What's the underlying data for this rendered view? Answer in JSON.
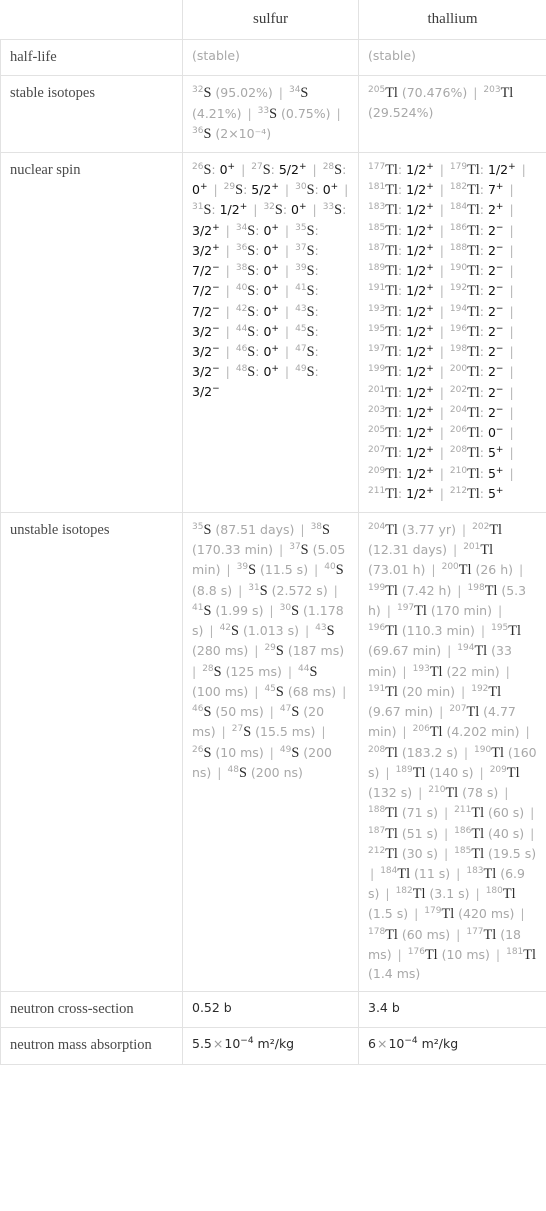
{
  "table": {
    "columns": [
      "",
      "sulfur",
      "thallium"
    ],
    "rows": [
      {
        "label": "half-life",
        "sulfur": "(stable)",
        "thallium": "(stable)"
      },
      {
        "label": "stable isotopes",
        "sulfur_items": [
          {
            "mass": "32",
            "sym": "S",
            "note": "(95.02%)"
          },
          {
            "mass": "34",
            "sym": "S",
            "note": "(4.21%)"
          },
          {
            "mass": "33",
            "sym": "S",
            "note": "(0.75%)"
          },
          {
            "mass": "36",
            "sym": "S",
            "note": "(2×10⁻⁴)"
          }
        ],
        "thallium_items": [
          {
            "mass": "205",
            "sym": "Tl",
            "note": "(70.476%)"
          },
          {
            "mass": "203",
            "sym": "Tl",
            "note": "(29.524%)"
          }
        ]
      },
      {
        "label": "nuclear spin",
        "sulfur_spins": [
          {
            "mass": "26",
            "sym": "S",
            "spin": "0",
            "sign": "+"
          },
          {
            "mass": "27",
            "sym": "S",
            "spin": "5/2",
            "sign": "+"
          },
          {
            "mass": "28",
            "sym": "S",
            "spin": "0",
            "sign": "+"
          },
          {
            "mass": "29",
            "sym": "S",
            "spin": "5/2",
            "sign": "+"
          },
          {
            "mass": "30",
            "sym": "S",
            "spin": "0",
            "sign": "+"
          },
          {
            "mass": "31",
            "sym": "S",
            "spin": "1/2",
            "sign": "+"
          },
          {
            "mass": "32",
            "sym": "S",
            "spin": "0",
            "sign": "+"
          },
          {
            "mass": "33",
            "sym": "S",
            "spin": "3/2",
            "sign": "+"
          },
          {
            "mass": "34",
            "sym": "S",
            "spin": "0",
            "sign": "+"
          },
          {
            "mass": "35",
            "sym": "S",
            "spin": "3/2",
            "sign": "+"
          },
          {
            "mass": "36",
            "sym": "S",
            "spin": "0",
            "sign": "+"
          },
          {
            "mass": "37",
            "sym": "S",
            "spin": "7/2",
            "sign": "−"
          },
          {
            "mass": "38",
            "sym": "S",
            "spin": "0",
            "sign": "+"
          },
          {
            "mass": "39",
            "sym": "S",
            "spin": "7/2",
            "sign": "−"
          },
          {
            "mass": "40",
            "sym": "S",
            "spin": "0",
            "sign": "+"
          },
          {
            "mass": "41",
            "sym": "S",
            "spin": "7/2",
            "sign": "−"
          },
          {
            "mass": "42",
            "sym": "S",
            "spin": "0",
            "sign": "+"
          },
          {
            "mass": "43",
            "sym": "S",
            "spin": "3/2",
            "sign": "−"
          },
          {
            "mass": "44",
            "sym": "S",
            "spin": "0",
            "sign": "+"
          },
          {
            "mass": "45",
            "sym": "S",
            "spin": "3/2",
            "sign": "−"
          },
          {
            "mass": "46",
            "sym": "S",
            "spin": "0",
            "sign": "+"
          },
          {
            "mass": "47",
            "sym": "S",
            "spin": "3/2",
            "sign": "−"
          },
          {
            "mass": "48",
            "sym": "S",
            "spin": "0",
            "sign": "+"
          },
          {
            "mass": "49",
            "sym": "S",
            "spin": "3/2",
            "sign": "−"
          }
        ],
        "thallium_spins": [
          {
            "mass": "177",
            "sym": "Tl",
            "spin": "1/2",
            "sign": "+"
          },
          {
            "mass": "179",
            "sym": "Tl",
            "spin": "1/2",
            "sign": "+"
          },
          {
            "mass": "181",
            "sym": "Tl",
            "spin": "1/2",
            "sign": "+"
          },
          {
            "mass": "182",
            "sym": "Tl",
            "spin": "7",
            "sign": "+"
          },
          {
            "mass": "183",
            "sym": "Tl",
            "spin": "1/2",
            "sign": "+"
          },
          {
            "mass": "184",
            "sym": "Tl",
            "spin": "2",
            "sign": "+"
          },
          {
            "mass": "185",
            "sym": "Tl",
            "spin": "1/2",
            "sign": "+"
          },
          {
            "mass": "186",
            "sym": "Tl",
            "spin": "2",
            "sign": "−"
          },
          {
            "mass": "187",
            "sym": "Tl",
            "spin": "1/2",
            "sign": "+"
          },
          {
            "mass": "188",
            "sym": "Tl",
            "spin": "2",
            "sign": "−"
          },
          {
            "mass": "189",
            "sym": "Tl",
            "spin": "1/2",
            "sign": "+"
          },
          {
            "mass": "190",
            "sym": "Tl",
            "spin": "2",
            "sign": "−"
          },
          {
            "mass": "191",
            "sym": "Tl",
            "spin": "1/2",
            "sign": "+"
          },
          {
            "mass": "192",
            "sym": "Tl",
            "spin": "2",
            "sign": "−"
          },
          {
            "mass": "193",
            "sym": "Tl",
            "spin": "1/2",
            "sign": "+"
          },
          {
            "mass": "194",
            "sym": "Tl",
            "spin": "2",
            "sign": "−"
          },
          {
            "mass": "195",
            "sym": "Tl",
            "spin": "1/2",
            "sign": "+"
          },
          {
            "mass": "196",
            "sym": "Tl",
            "spin": "2",
            "sign": "−"
          },
          {
            "mass": "197",
            "sym": "Tl",
            "spin": "1/2",
            "sign": "+"
          },
          {
            "mass": "198",
            "sym": "Tl",
            "spin": "2",
            "sign": "−"
          },
          {
            "mass": "199",
            "sym": "Tl",
            "spin": "1/2",
            "sign": "+"
          },
          {
            "mass": "200",
            "sym": "Tl",
            "spin": "2",
            "sign": "−"
          },
          {
            "mass": "201",
            "sym": "Tl",
            "spin": "1/2",
            "sign": "+"
          },
          {
            "mass": "202",
            "sym": "Tl",
            "spin": "2",
            "sign": "−"
          },
          {
            "mass": "203",
            "sym": "Tl",
            "spin": "1/2",
            "sign": "+"
          },
          {
            "mass": "204",
            "sym": "Tl",
            "spin": "2",
            "sign": "−"
          },
          {
            "mass": "205",
            "sym": "Tl",
            "spin": "1/2",
            "sign": "+"
          },
          {
            "mass": "206",
            "sym": "Tl",
            "spin": "0",
            "sign": "−"
          },
          {
            "mass": "207",
            "sym": "Tl",
            "spin": "1/2",
            "sign": "+"
          },
          {
            "mass": "208",
            "sym": "Tl",
            "spin": "5",
            "sign": "+"
          },
          {
            "mass": "209",
            "sym": "Tl",
            "spin": "1/2",
            "sign": "+"
          },
          {
            "mass": "210",
            "sym": "Tl",
            "spin": "5",
            "sign": "+"
          },
          {
            "mass": "211",
            "sym": "Tl",
            "spin": "1/2",
            "sign": "+"
          },
          {
            "mass": "212",
            "sym": "Tl",
            "spin": "5",
            "sign": "+"
          }
        ]
      },
      {
        "label": "unstable isotopes",
        "sulfur_items": [
          {
            "mass": "35",
            "sym": "S",
            "note": "(87.51 days)"
          },
          {
            "mass": "38",
            "sym": "S",
            "note": "(170.33 min)"
          },
          {
            "mass": "37",
            "sym": "S",
            "note": "(5.05 min)"
          },
          {
            "mass": "39",
            "sym": "S",
            "note": "(11.5 s)"
          },
          {
            "mass": "40",
            "sym": "S",
            "note": "(8.8 s)"
          },
          {
            "mass": "31",
            "sym": "S",
            "note": "(2.572 s)"
          },
          {
            "mass": "41",
            "sym": "S",
            "note": "(1.99 s)"
          },
          {
            "mass": "30",
            "sym": "S",
            "note": "(1.178 s)"
          },
          {
            "mass": "42",
            "sym": "S",
            "note": "(1.013 s)"
          },
          {
            "mass": "43",
            "sym": "S",
            "note": "(280 ms)"
          },
          {
            "mass": "29",
            "sym": "S",
            "note": "(187 ms)"
          },
          {
            "mass": "28",
            "sym": "S",
            "note": "(125 ms)"
          },
          {
            "mass": "44",
            "sym": "S",
            "note": "(100 ms)"
          },
          {
            "mass": "45",
            "sym": "S",
            "note": "(68 ms)"
          },
          {
            "mass": "46",
            "sym": "S",
            "note": "(50 ms)"
          },
          {
            "mass": "47",
            "sym": "S",
            "note": "(20 ms)"
          },
          {
            "mass": "27",
            "sym": "S",
            "note": "(15.5 ms)"
          },
          {
            "mass": "26",
            "sym": "S",
            "note": "(10 ms)"
          },
          {
            "mass": "49",
            "sym": "S",
            "note": "(200 ns)"
          },
          {
            "mass": "48",
            "sym": "S",
            "note": "(200 ns)"
          }
        ],
        "thallium_items": [
          {
            "mass": "204",
            "sym": "Tl",
            "note": "(3.77 yr)"
          },
          {
            "mass": "202",
            "sym": "Tl",
            "note": "(12.31 days)"
          },
          {
            "mass": "201",
            "sym": "Tl",
            "note": "(73.01 h)"
          },
          {
            "mass": "200",
            "sym": "Tl",
            "note": "(26 h)"
          },
          {
            "mass": "199",
            "sym": "Tl",
            "note": "(7.42 h)"
          },
          {
            "mass": "198",
            "sym": "Tl",
            "note": "(5.3 h)"
          },
          {
            "mass": "197",
            "sym": "Tl",
            "note": "(170 min)"
          },
          {
            "mass": "196",
            "sym": "Tl",
            "note": "(110.3 min)"
          },
          {
            "mass": "195",
            "sym": "Tl",
            "note": "(69.67 min)"
          },
          {
            "mass": "194",
            "sym": "Tl",
            "note": "(33 min)"
          },
          {
            "mass": "193",
            "sym": "Tl",
            "note": "(22 min)"
          },
          {
            "mass": "191",
            "sym": "Tl",
            "note": "(20 min)"
          },
          {
            "mass": "192",
            "sym": "Tl",
            "note": "(9.67 min)"
          },
          {
            "mass": "207",
            "sym": "Tl",
            "note": "(4.77 min)"
          },
          {
            "mass": "206",
            "sym": "Tl",
            "note": "(4.202 min)"
          },
          {
            "mass": "208",
            "sym": "Tl",
            "note": "(183.2 s)"
          },
          {
            "mass": "190",
            "sym": "Tl",
            "note": "(160 s)"
          },
          {
            "mass": "189",
            "sym": "Tl",
            "note": "(140 s)"
          },
          {
            "mass": "209",
            "sym": "Tl",
            "note": "(132 s)"
          },
          {
            "mass": "210",
            "sym": "Tl",
            "note": "(78 s)"
          },
          {
            "mass": "188",
            "sym": "Tl",
            "note": "(71 s)"
          },
          {
            "mass": "211",
            "sym": "Tl",
            "note": "(60 s)"
          },
          {
            "mass": "187",
            "sym": "Tl",
            "note": "(51 s)"
          },
          {
            "mass": "186",
            "sym": "Tl",
            "note": "(40 s)"
          },
          {
            "mass": "212",
            "sym": "Tl",
            "note": "(30 s)"
          },
          {
            "mass": "185",
            "sym": "Tl",
            "note": "(19.5 s)"
          },
          {
            "mass": "184",
            "sym": "Tl",
            "note": "(11 s)"
          },
          {
            "mass": "183",
            "sym": "Tl",
            "note": "(6.9 s)"
          },
          {
            "mass": "182",
            "sym": "Tl",
            "note": "(3.1 s)"
          },
          {
            "mass": "180",
            "sym": "Tl",
            "note": "(1.5 s)"
          },
          {
            "mass": "179",
            "sym": "Tl",
            "note": "(420 ms)"
          },
          {
            "mass": "178",
            "sym": "Tl",
            "note": "(60 ms)"
          },
          {
            "mass": "177",
            "sym": "Tl",
            "note": "(18 ms)"
          },
          {
            "mass": "176",
            "sym": "Tl",
            "note": "(10 ms)"
          },
          {
            "mass": "181",
            "sym": "Tl",
            "note": "(1.4 ms)"
          }
        ]
      },
      {
        "label": "neutron cross-section",
        "sulfur": "0.52 b",
        "thallium": "3.4 b"
      },
      {
        "label": "neutron mass absorption",
        "sulfur_mantissa": "5.5",
        "sulfur_exp": "−4",
        "sulfur_unit": "m²/kg",
        "thallium_mantissa": "6",
        "thallium_exp": "−4",
        "thallium_unit": "m²/kg"
      }
    ]
  },
  "separator": "|",
  "colors": {
    "border": "#e2e2e2",
    "label_text": "#4a4a4a",
    "value_text": "#2b2b2b",
    "dim_text": "#a8a8a8"
  }
}
